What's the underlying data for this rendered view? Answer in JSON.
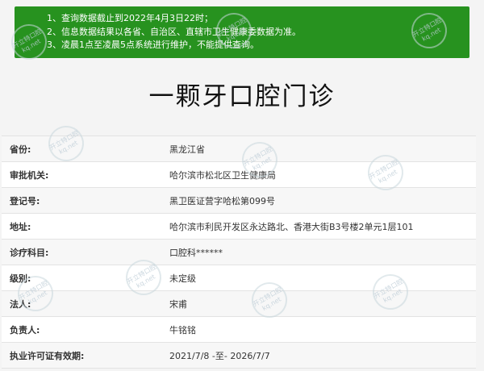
{
  "notice": {
    "lines": [
      "1、查询数据截止到2022年4月3日22时；",
      "2、信息数据结果以各省、自治区、直辖市卫生健康委数据为准。",
      "3、凌晨1点至凌晨5点系统进行维护，不能提供查询。"
    ],
    "background_color": "#27921f"
  },
  "clinic": {
    "name": "一颗牙口腔门诊"
  },
  "details": [
    {
      "label": "省份:",
      "value": "黑龙江省"
    },
    {
      "label": "审批机关:",
      "value": "哈尔滨市松北区卫生健康局"
    },
    {
      "label": "登记号:",
      "value": "黑卫医证营字哈松第099号"
    },
    {
      "label": "地址:",
      "value": "哈尔滨市利民开发区永达路北、香港大街B3号楼2单元1层101"
    },
    {
      "label": "诊疗科目:",
      "value": "口腔科******"
    },
    {
      "label": "级别:",
      "value": "未定级"
    },
    {
      "label": "法人:",
      "value": "宋甫"
    },
    {
      "label": "负责人:",
      "value": "牛铭铭"
    },
    {
      "label": "执业许可证有效期:",
      "value": "2021/7/8 -至- 2026/7/7"
    }
  ],
  "watermark": {
    "text": "开立特口腔",
    "subtext": "kq.net"
  }
}
